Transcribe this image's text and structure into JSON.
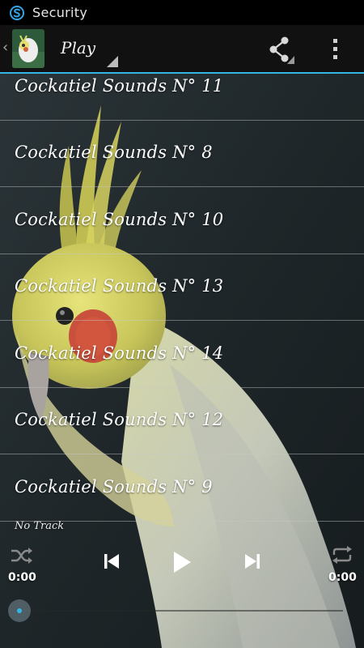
{
  "status_bar": {
    "app_name": "Security",
    "icon": "security-app-icon"
  },
  "action_bar": {
    "title": "Play",
    "up_icon": "chevron-left-icon",
    "logo_icon": "cockatiel-logo",
    "share_icon": "share-icon",
    "overflow_icon": "overflow-menu-icon",
    "accent": "#33b5e5"
  },
  "tracks": [
    {
      "label": "Cockatiel Sounds N° 11"
    },
    {
      "label": "Cockatiel Sounds N° 8"
    },
    {
      "label": "Cockatiel Sounds N° 10"
    },
    {
      "label": "Cockatiel Sounds N° 13"
    },
    {
      "label": "Cockatiel Sounds N° 14"
    },
    {
      "label": "Cockatiel Sounds N° 12"
    },
    {
      "label": "Cockatiel Sounds N° 9"
    }
  ],
  "player": {
    "now_playing": "No Track",
    "elapsed": "0:00",
    "duration": "0:00",
    "progress_fraction": 0,
    "icons": {
      "shuffle": "shuffle-icon",
      "previous": "skip-previous-icon",
      "play": "play-icon",
      "next": "skip-next-icon",
      "repeat": "repeat-icon"
    }
  }
}
